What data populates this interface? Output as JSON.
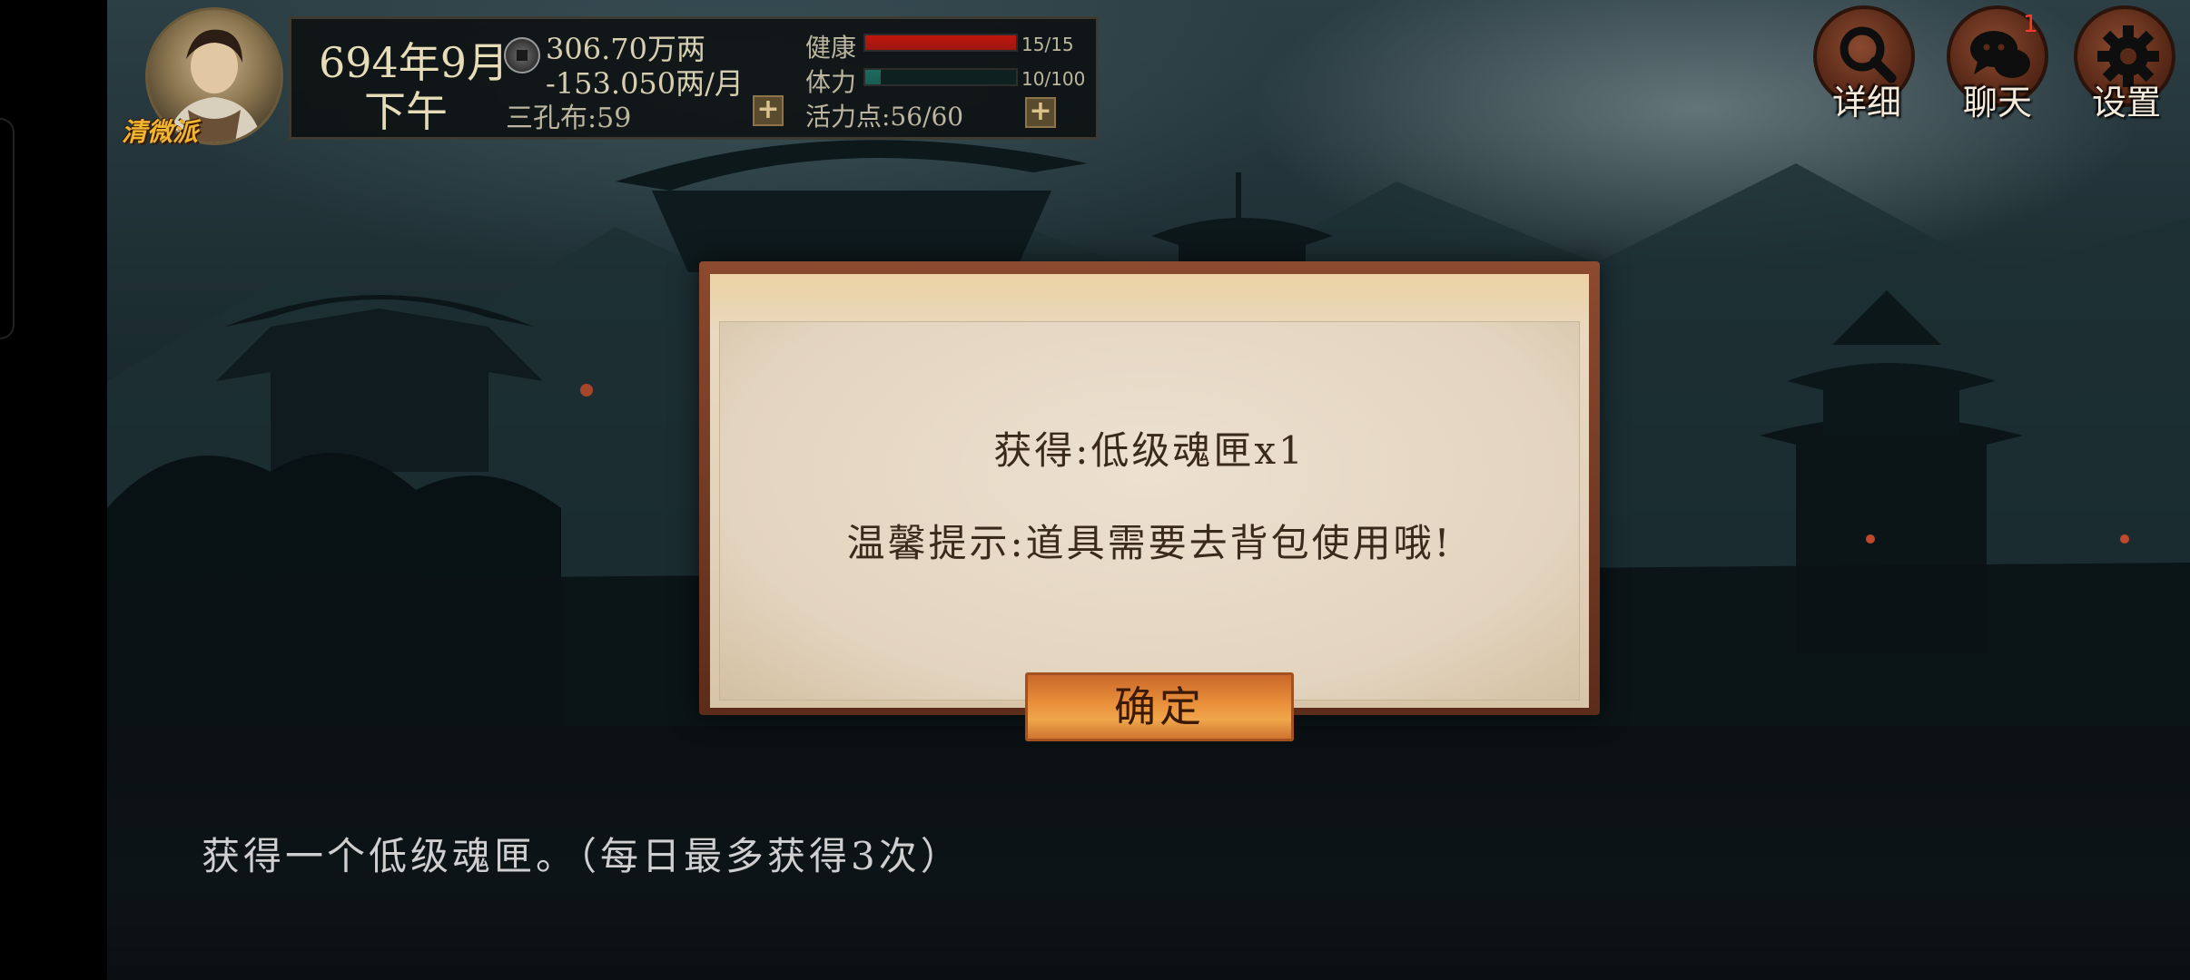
{
  "player": {
    "sect": "清微派",
    "date": "694年9月",
    "time_of_day": "下午",
    "money": "306.70万两",
    "income": "-153.050两/月",
    "cloth": "三孔布:59"
  },
  "stats": {
    "health": {
      "label": "健康",
      "value": "15/15",
      "fraction": 1.0,
      "color": "#c0160e"
    },
    "stamina": {
      "label": "体力",
      "value": "10/100",
      "fraction": 0.1,
      "color": "#1d6b5e"
    },
    "vitality": {
      "label": "活力点:56/60"
    }
  },
  "top_buttons": {
    "detail": {
      "label": "详细",
      "icon": "magnifier-icon"
    },
    "chat": {
      "label": "聊天",
      "icon": "chat-bubbles-icon",
      "badge": "1"
    },
    "settings": {
      "label": "设置",
      "icon": "gear-icon"
    }
  },
  "modal": {
    "line1": "获得:低级魂匣x1",
    "line2": "温馨提示:道具需要去背包使用哦!",
    "confirm_label": "确定"
  },
  "narrative": {
    "text": "获得一个低级魂匣。（每日最多获得3次）"
  },
  "colors": {
    "accent_gold": "#f0b531",
    "modal_frame": "#8c4a2f",
    "confirm_button": "#e9903a"
  }
}
